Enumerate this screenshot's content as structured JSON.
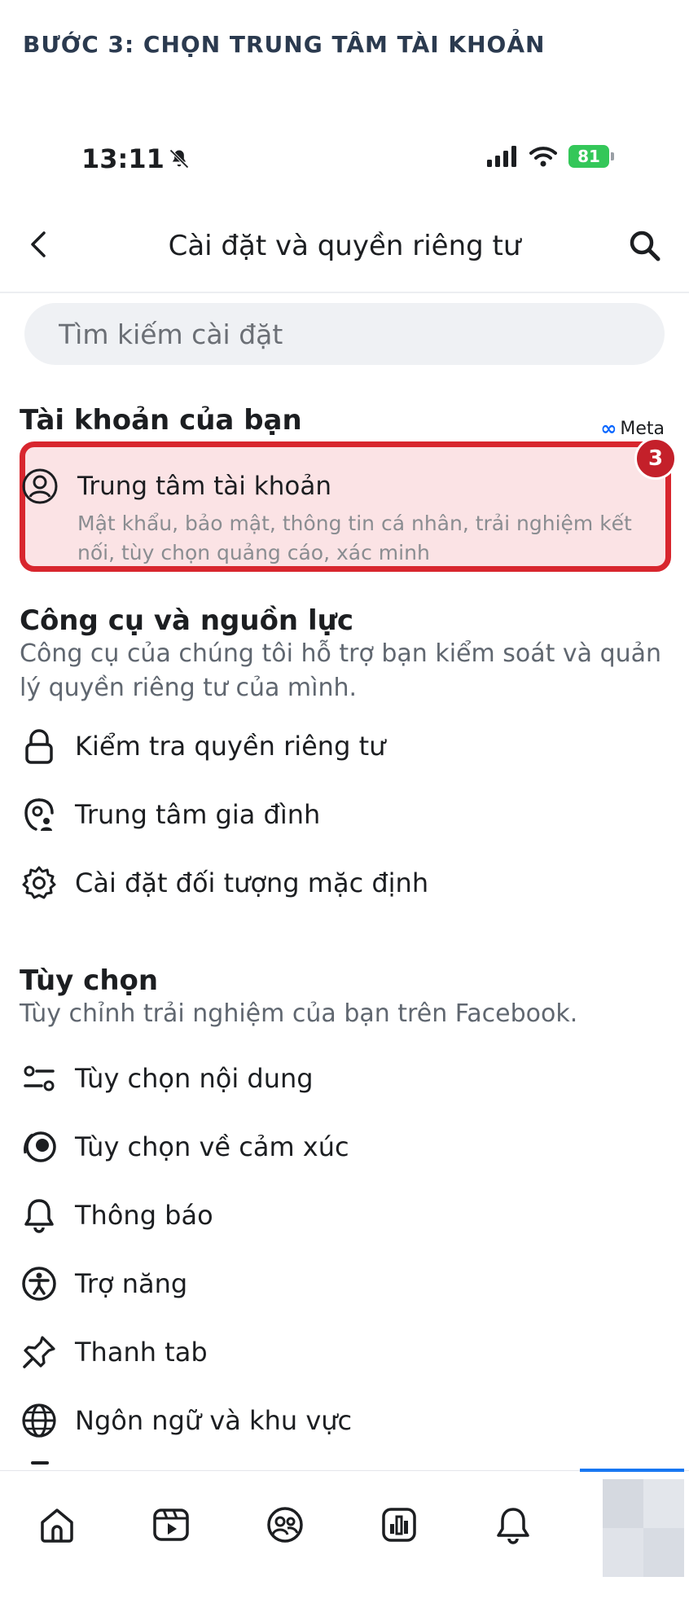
{
  "caption": "BƯỚC 3: CHỌN TRUNG TÂM TÀI KHOẢN",
  "status_bar": {
    "time": "13:11",
    "battery": "81",
    "icons": [
      "bell-muted-icon",
      "signal-icon",
      "wifi-icon",
      "battery-icon"
    ]
  },
  "header": {
    "title": "Cài đặt và quyền riêng tư",
    "back_icon": "chevron-left-icon",
    "search_icon": "search-icon"
  },
  "search": {
    "placeholder": "Tìm kiếm cài đặt"
  },
  "account_section": {
    "title": "Tài khoản của bạn",
    "meta_label": "Meta",
    "item": {
      "title": "Trung tâm tài khoản",
      "description": "Mật khẩu, bảo mật, thông tin cá nhân, trải nghiệm kết nối, tùy chọn quảng cáo, xác minh",
      "icon": "user-circle-icon"
    },
    "step_badge": "3",
    "highlight_color": "#d8262e"
  },
  "tools_section": {
    "title": "Công cụ và nguồn lực",
    "subtitle": "Công cụ của chúng tôi hỗ trợ bạn kiểm soát và quản lý quyền riêng tư của mình.",
    "items": [
      {
        "label": "Kiểm tra quyền riêng tư",
        "icon": "lock-icon"
      },
      {
        "label": "Trung tâm gia đình",
        "icon": "family-icon"
      },
      {
        "label": "Cài đặt đối tượng mặc định",
        "icon": "gear-icon"
      }
    ]
  },
  "preferences_section": {
    "title": "Tùy chọn",
    "subtitle": "Tùy chỉnh trải nghiệm của bạn trên Facebook.",
    "items": [
      {
        "label": "Tùy chọn nội dung",
        "icon": "sliders-icon"
      },
      {
        "label": "Tùy chọn về cảm xúc",
        "icon": "reaction-icon"
      },
      {
        "label": "Thông báo",
        "icon": "bell-icon"
      },
      {
        "label": "Trợ năng",
        "icon": "accessibility-icon"
      },
      {
        "label": "Thanh tab",
        "icon": "pin-icon"
      },
      {
        "label": "Ngôn ngữ và khu vực",
        "icon": "globe-icon"
      }
    ]
  },
  "tab_bar": {
    "tabs": [
      "home-icon",
      "video-icon",
      "friends-icon",
      "dashboard-icon",
      "bell-icon",
      "profile-avatar"
    ],
    "active_color": "#1877f2"
  }
}
